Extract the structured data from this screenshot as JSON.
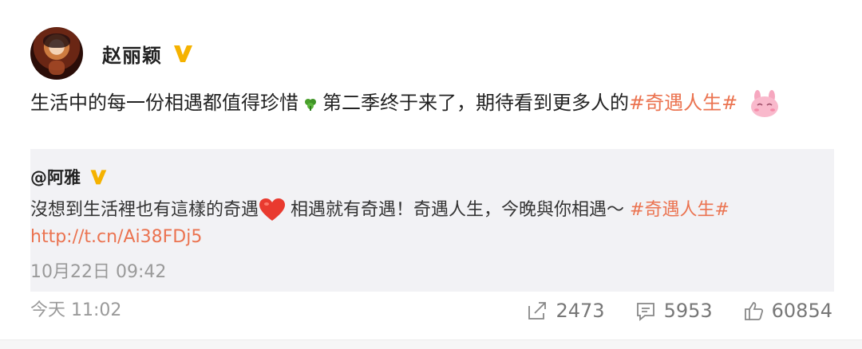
{
  "post": {
    "author": "赵丽颖",
    "text_part1": "生活中的每一份相遇都值得珍惜",
    "text_part2": "第二季终于来了，期待看到更多人的",
    "topic": "#奇遇人生#",
    "time": "今天 11:02"
  },
  "repost": {
    "author": "@阿雅",
    "text_part1": "沒想到生活裡也有這樣的奇遇",
    "text_part2": "相遇就有奇遇！奇遇人生，今晚與你相遇～",
    "topic": "#奇遇人生#",
    "link": "http://t.cn/Ai38FDj5",
    "time": "10月22日 09:42"
  },
  "actions": {
    "share_count": "2473",
    "comment_count": "5953",
    "like_count": "60854"
  },
  "colors": {
    "accent": "#eb7350",
    "vip": "#f5b200"
  },
  "icons": [
    "avatar",
    "verified-badge-icon",
    "clover-emoji-icon",
    "bunny-emoji-icon",
    "heart-emoji-icon",
    "share-icon",
    "comment-icon",
    "like-icon"
  ]
}
